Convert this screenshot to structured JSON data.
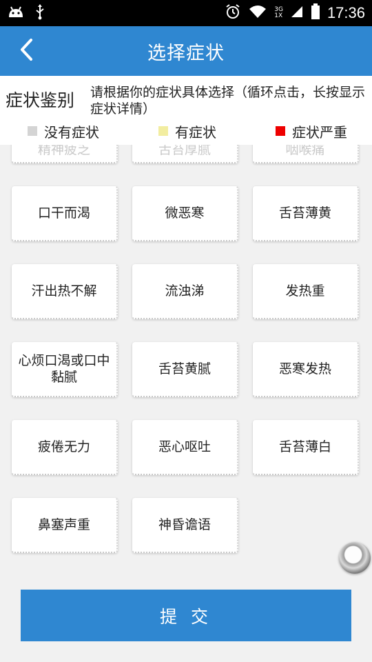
{
  "status_bar": {
    "time": "17:36",
    "network_top": "3G",
    "network_bottom": "1X",
    "icons": [
      "android-icon",
      "usb-icon",
      "alarm-icon",
      "wifi-icon",
      "signal-icon",
      "battery-icon"
    ]
  },
  "app_bar": {
    "title": "选择症状",
    "back_icon": "back-arrow-icon",
    "color": "#2f87d1"
  },
  "info": {
    "title": "症状鉴别",
    "description": "请根据你的症状具体选择（循环点击，长按显示症状详情）"
  },
  "legend": [
    {
      "label": "没有症状",
      "color": "#d4d4d4"
    },
    {
      "label": "有症状",
      "color": "#f2eda0"
    },
    {
      "label": "症状严重",
      "color": "#ee0000"
    }
  ],
  "symptoms_partial": [
    "精神疲乏",
    "舌苔厚腻",
    "咽喉痛"
  ],
  "symptoms": [
    "口干而渴",
    "微恶寒",
    "舌苔薄黄",
    "汗出热不解",
    "流浊涕",
    "发热重",
    "心烦口渴或口中黏腻",
    "舌苔黄腻",
    "恶寒发热",
    "疲倦无力",
    "恶心呕吐",
    "舌苔薄白",
    "鼻塞声重",
    "神昏谵语"
  ],
  "submit_label": "提 交"
}
